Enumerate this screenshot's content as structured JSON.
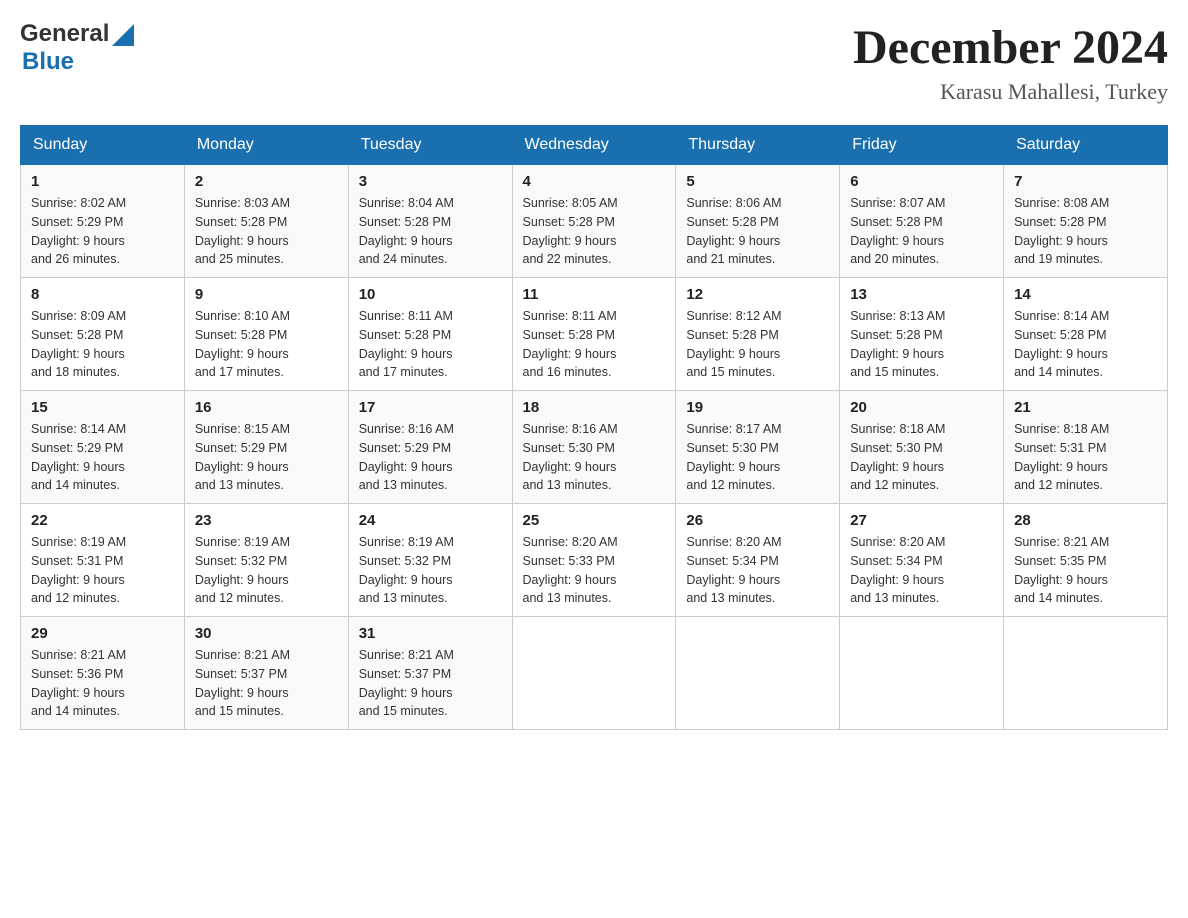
{
  "header": {
    "logo_general": "General",
    "logo_blue": "Blue",
    "month_title": "December 2024",
    "location": "Karasu Mahallesi, Turkey"
  },
  "days_of_week": [
    "Sunday",
    "Monday",
    "Tuesday",
    "Wednesday",
    "Thursday",
    "Friday",
    "Saturday"
  ],
  "weeks": [
    [
      {
        "day": "1",
        "sunrise": "8:02 AM",
        "sunset": "5:29 PM",
        "daylight": "9 hours and 26 minutes."
      },
      {
        "day": "2",
        "sunrise": "8:03 AM",
        "sunset": "5:28 PM",
        "daylight": "9 hours and 25 minutes."
      },
      {
        "day": "3",
        "sunrise": "8:04 AM",
        "sunset": "5:28 PM",
        "daylight": "9 hours and 24 minutes."
      },
      {
        "day": "4",
        "sunrise": "8:05 AM",
        "sunset": "5:28 PM",
        "daylight": "9 hours and 22 minutes."
      },
      {
        "day": "5",
        "sunrise": "8:06 AM",
        "sunset": "5:28 PM",
        "daylight": "9 hours and 21 minutes."
      },
      {
        "day": "6",
        "sunrise": "8:07 AM",
        "sunset": "5:28 PM",
        "daylight": "9 hours and 20 minutes."
      },
      {
        "day": "7",
        "sunrise": "8:08 AM",
        "sunset": "5:28 PM",
        "daylight": "9 hours and 19 minutes."
      }
    ],
    [
      {
        "day": "8",
        "sunrise": "8:09 AM",
        "sunset": "5:28 PM",
        "daylight": "9 hours and 18 minutes."
      },
      {
        "day": "9",
        "sunrise": "8:10 AM",
        "sunset": "5:28 PM",
        "daylight": "9 hours and 17 minutes."
      },
      {
        "day": "10",
        "sunrise": "8:11 AM",
        "sunset": "5:28 PM",
        "daylight": "9 hours and 17 minutes."
      },
      {
        "day": "11",
        "sunrise": "8:11 AM",
        "sunset": "5:28 PM",
        "daylight": "9 hours and 16 minutes."
      },
      {
        "day": "12",
        "sunrise": "8:12 AM",
        "sunset": "5:28 PM",
        "daylight": "9 hours and 15 minutes."
      },
      {
        "day": "13",
        "sunrise": "8:13 AM",
        "sunset": "5:28 PM",
        "daylight": "9 hours and 15 minutes."
      },
      {
        "day": "14",
        "sunrise": "8:14 AM",
        "sunset": "5:28 PM",
        "daylight": "9 hours and 14 minutes."
      }
    ],
    [
      {
        "day": "15",
        "sunrise": "8:14 AM",
        "sunset": "5:29 PM",
        "daylight": "9 hours and 14 minutes."
      },
      {
        "day": "16",
        "sunrise": "8:15 AM",
        "sunset": "5:29 PM",
        "daylight": "9 hours and 13 minutes."
      },
      {
        "day": "17",
        "sunrise": "8:16 AM",
        "sunset": "5:29 PM",
        "daylight": "9 hours and 13 minutes."
      },
      {
        "day": "18",
        "sunrise": "8:16 AM",
        "sunset": "5:30 PM",
        "daylight": "9 hours and 13 minutes."
      },
      {
        "day": "19",
        "sunrise": "8:17 AM",
        "sunset": "5:30 PM",
        "daylight": "9 hours and 12 minutes."
      },
      {
        "day": "20",
        "sunrise": "8:18 AM",
        "sunset": "5:30 PM",
        "daylight": "9 hours and 12 minutes."
      },
      {
        "day": "21",
        "sunrise": "8:18 AM",
        "sunset": "5:31 PM",
        "daylight": "9 hours and 12 minutes."
      }
    ],
    [
      {
        "day": "22",
        "sunrise": "8:19 AM",
        "sunset": "5:31 PM",
        "daylight": "9 hours and 12 minutes."
      },
      {
        "day": "23",
        "sunrise": "8:19 AM",
        "sunset": "5:32 PM",
        "daylight": "9 hours and 12 minutes."
      },
      {
        "day": "24",
        "sunrise": "8:19 AM",
        "sunset": "5:32 PM",
        "daylight": "9 hours and 13 minutes."
      },
      {
        "day": "25",
        "sunrise": "8:20 AM",
        "sunset": "5:33 PM",
        "daylight": "9 hours and 13 minutes."
      },
      {
        "day": "26",
        "sunrise": "8:20 AM",
        "sunset": "5:34 PM",
        "daylight": "9 hours and 13 minutes."
      },
      {
        "day": "27",
        "sunrise": "8:20 AM",
        "sunset": "5:34 PM",
        "daylight": "9 hours and 13 minutes."
      },
      {
        "day": "28",
        "sunrise": "8:21 AM",
        "sunset": "5:35 PM",
        "daylight": "9 hours and 14 minutes."
      }
    ],
    [
      {
        "day": "29",
        "sunrise": "8:21 AM",
        "sunset": "5:36 PM",
        "daylight": "9 hours and 14 minutes."
      },
      {
        "day": "30",
        "sunrise": "8:21 AM",
        "sunset": "5:37 PM",
        "daylight": "9 hours and 15 minutes."
      },
      {
        "day": "31",
        "sunrise": "8:21 AM",
        "sunset": "5:37 PM",
        "daylight": "9 hours and 15 minutes."
      },
      null,
      null,
      null,
      null
    ]
  ],
  "labels": {
    "sunrise": "Sunrise:",
    "sunset": "Sunset:",
    "daylight": "Daylight:"
  }
}
